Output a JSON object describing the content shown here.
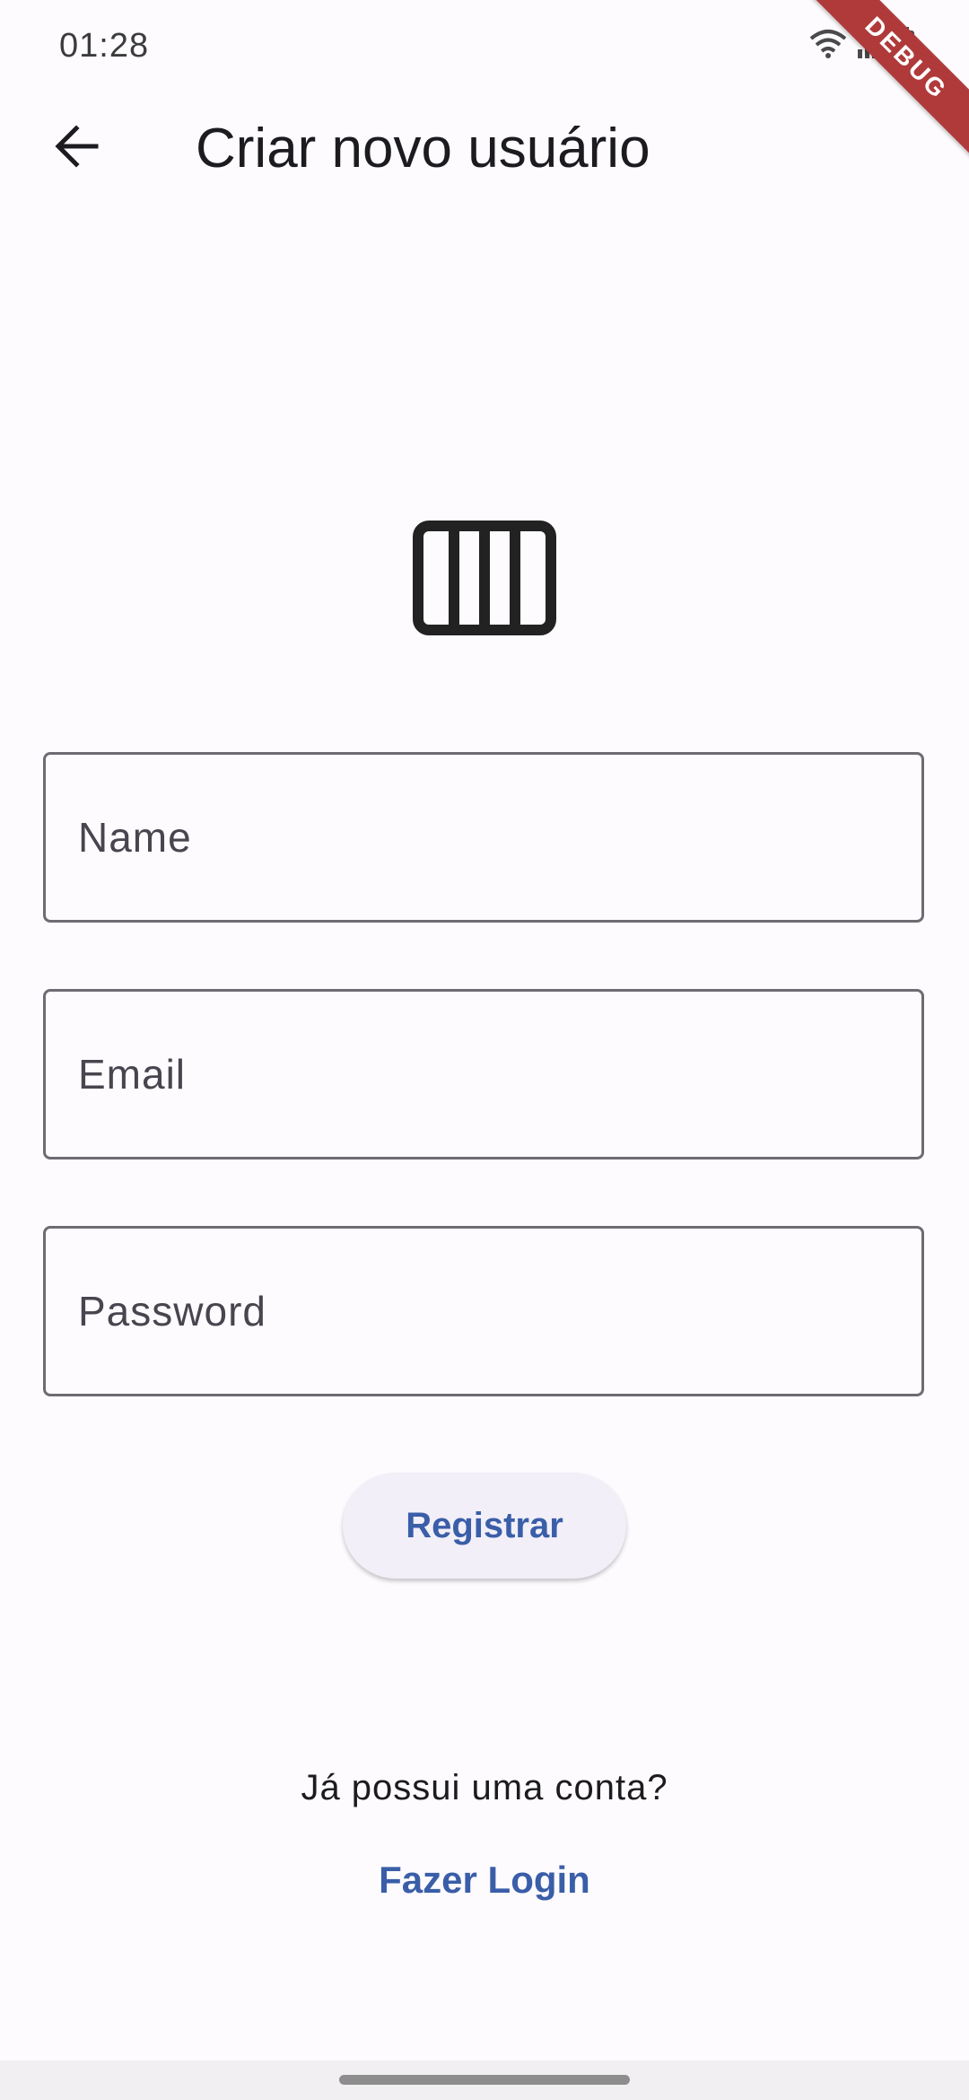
{
  "status_bar": {
    "time": "01:28",
    "icons": [
      "wifi-icon",
      "signal-icon",
      "battery-icon"
    ]
  },
  "debug_banner": "DEBUG",
  "app_bar": {
    "back_icon": "arrow-back-icon",
    "title": "Criar novo usuário"
  },
  "logo": {
    "icon": "view-week-icon"
  },
  "form": {
    "name_placeholder": "Name",
    "name_value": "",
    "email_placeholder": "Email",
    "email_value": "",
    "password_placeholder": "Password",
    "password_value": "",
    "register_label": "Registrar"
  },
  "footer": {
    "question": "Já possui uma conta?",
    "login_label": "Fazer Login"
  },
  "colors": {
    "background": "#fdfbfe",
    "accent": "#3a5ea8",
    "outline": "#6f6b72",
    "button_bg": "#f2eff8",
    "debug": "#b03a3a"
  }
}
